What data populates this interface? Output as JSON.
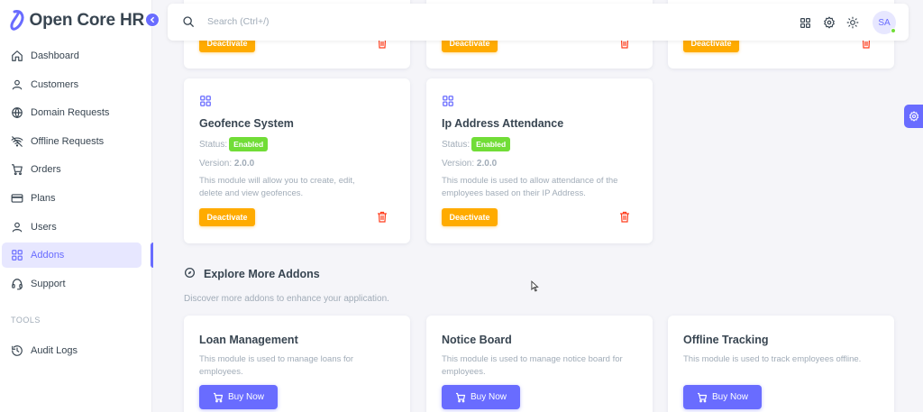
{
  "app": {
    "brand": "Open Core HR"
  },
  "sidebar": {
    "items": [
      {
        "label": "Dashboard",
        "icon": "home-icon"
      },
      {
        "label": "Customers",
        "icon": "user-icon"
      },
      {
        "label": "Domain Requests",
        "icon": "globe-icon"
      },
      {
        "label": "Offline Requests",
        "icon": "wifi-off-icon"
      },
      {
        "label": "Orders",
        "icon": "cart-icon"
      },
      {
        "label": "Plans",
        "icon": "credit-card-icon"
      },
      {
        "label": "Users",
        "icon": "user-icon"
      },
      {
        "label": "Addons",
        "icon": "grid-icon",
        "active": true
      },
      {
        "label": "Support",
        "icon": "headset-icon"
      }
    ],
    "tools_label": "TOOLS",
    "tools_items": [
      {
        "label": "Audit Logs",
        "icon": "history-icon"
      }
    ]
  },
  "topbar": {
    "search_placeholder": "Search (Ctrl+/)",
    "avatar_initials": "SA"
  },
  "installed": {
    "top_row_button": "Deactivate",
    "cards": [
      {
        "title": "Geofence System",
        "status_label": "Status:",
        "status": "Enabled",
        "version_label": "Version:",
        "version": "2.0.0",
        "description": "This module will allow you to create, edit, delete and view geofences.",
        "button": "Deactivate"
      },
      {
        "title": "Ip Address Attendance",
        "status_label": "Status:",
        "status": "Enabled",
        "version_label": "Version:",
        "version": "2.0.0",
        "description": "This module is used to allow attendance of the employees based on their IP Address.",
        "button": "Deactivate"
      }
    ]
  },
  "explore": {
    "title": "Explore More Addons",
    "subtitle": "Discover more addons to enhance your application.",
    "cards": [
      {
        "title": "Loan Management",
        "description": "This module is used to manage loans for employees.",
        "button": "Buy Now"
      },
      {
        "title": "Notice Board",
        "description": "This module is used to manage notice board for employees.",
        "button": "Buy Now"
      },
      {
        "title": "Offline Tracking",
        "description": "This module is used to track employees offline.",
        "button": "Buy Now"
      }
    ]
  },
  "colors": {
    "primary": "#696cff",
    "warning": "#ffab00",
    "success": "#71dd37",
    "danger": "#ff3e1d"
  }
}
